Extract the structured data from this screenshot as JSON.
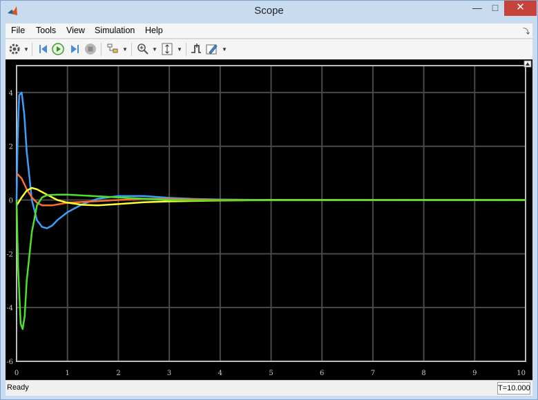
{
  "window": {
    "title": "Scope"
  },
  "menu": [
    "File",
    "Tools",
    "View",
    "Simulation",
    "Help"
  ],
  "toolbar": {
    "icons": [
      "gear-icon",
      "step-back-icon",
      "run-icon",
      "step-forward-icon",
      "stop-icon",
      "highlight-block-icon",
      "zoom-in-icon",
      "scale-axes-icon",
      "triggers-icon",
      "cursor-measurements-icon"
    ]
  },
  "status": {
    "text": "Ready",
    "time": "T=10.000"
  },
  "colors": {
    "series_blue": "#3aa0ff",
    "series_orange": "#ff6d2e",
    "series_yellow": "#ffff33",
    "series_green": "#4fe02a",
    "background": "#000000",
    "grid": "#4a4a4a"
  },
  "chart_data": {
    "type": "line",
    "xlim": [
      0,
      10
    ],
    "ylim": [
      -6,
      5
    ],
    "x_ticks": [
      "0",
      "1",
      "2",
      "3",
      "4",
      "5",
      "6",
      "7",
      "8",
      "9",
      "10"
    ],
    "y_ticks": [
      "4",
      "2",
      "0",
      "-2",
      "-4",
      "-6"
    ],
    "grid": true,
    "series": [
      {
        "color": "#3aa0ff",
        "points": [
          [
            0,
            0
          ],
          [
            0.02,
            2.2
          ],
          [
            0.05,
            3.9
          ],
          [
            0.1,
            4.0
          ],
          [
            0.15,
            3.2
          ],
          [
            0.2,
            1.8
          ],
          [
            0.3,
            0
          ],
          [
            0.4,
            -0.75
          ],
          [
            0.5,
            -1.0
          ],
          [
            0.6,
            -1.05
          ],
          [
            0.7,
            -0.95
          ],
          [
            0.8,
            -0.75
          ],
          [
            1.0,
            -0.45
          ],
          [
            1.3,
            -0.15
          ],
          [
            1.6,
            0.05
          ],
          [
            2.0,
            0.15
          ],
          [
            2.5,
            0.15
          ],
          [
            3.0,
            0.08
          ],
          [
            3.5,
            0.04
          ],
          [
            4.0,
            0.02
          ],
          [
            5.0,
            0.0
          ],
          [
            10,
            0
          ]
        ]
      },
      {
        "color": "#ff6d2e",
        "points": [
          [
            0,
            1.0
          ],
          [
            0.1,
            0.8
          ],
          [
            0.2,
            0.4
          ],
          [
            0.3,
            0.1
          ],
          [
            0.4,
            -0.1
          ],
          [
            0.5,
            -0.2
          ],
          [
            0.7,
            -0.2
          ],
          [
            1.0,
            -0.1
          ],
          [
            1.5,
            -0.05
          ],
          [
            2.0,
            0.0
          ],
          [
            2.5,
            0.05
          ],
          [
            3.0,
            0.04
          ],
          [
            4.0,
            0.01
          ],
          [
            5.0,
            0.0
          ],
          [
            10,
            0
          ]
        ]
      },
      {
        "color": "#ffff33",
        "points": [
          [
            0,
            -0.2
          ],
          [
            0.1,
            0.1
          ],
          [
            0.2,
            0.35
          ],
          [
            0.3,
            0.45
          ],
          [
            0.4,
            0.4
          ],
          [
            0.6,
            0.2
          ],
          [
            0.8,
            0.0
          ],
          [
            1.0,
            -0.1
          ],
          [
            1.3,
            -0.18
          ],
          [
            1.6,
            -0.2
          ],
          [
            2.0,
            -0.15
          ],
          [
            2.5,
            -0.08
          ],
          [
            3.0,
            -0.05
          ],
          [
            4.0,
            -0.02
          ],
          [
            5.0,
            0.0
          ],
          [
            10,
            0
          ]
        ]
      },
      {
        "color": "#4fe02a",
        "points": [
          [
            0,
            0
          ],
          [
            0.03,
            -2.5
          ],
          [
            0.08,
            -4.6
          ],
          [
            0.12,
            -4.8
          ],
          [
            0.16,
            -4.3
          ],
          [
            0.2,
            -3.0
          ],
          [
            0.3,
            -1.2
          ],
          [
            0.4,
            -0.2
          ],
          [
            0.5,
            0.1
          ],
          [
            0.6,
            0.18
          ],
          [
            0.8,
            0.2
          ],
          [
            1.0,
            0.2
          ],
          [
            1.5,
            0.15
          ],
          [
            2.0,
            0.1
          ],
          [
            2.5,
            0.05
          ],
          [
            3.0,
            0.0
          ],
          [
            3.5,
            -0.02
          ],
          [
            4.0,
            -0.01
          ],
          [
            10,
            0
          ]
        ]
      }
    ]
  }
}
